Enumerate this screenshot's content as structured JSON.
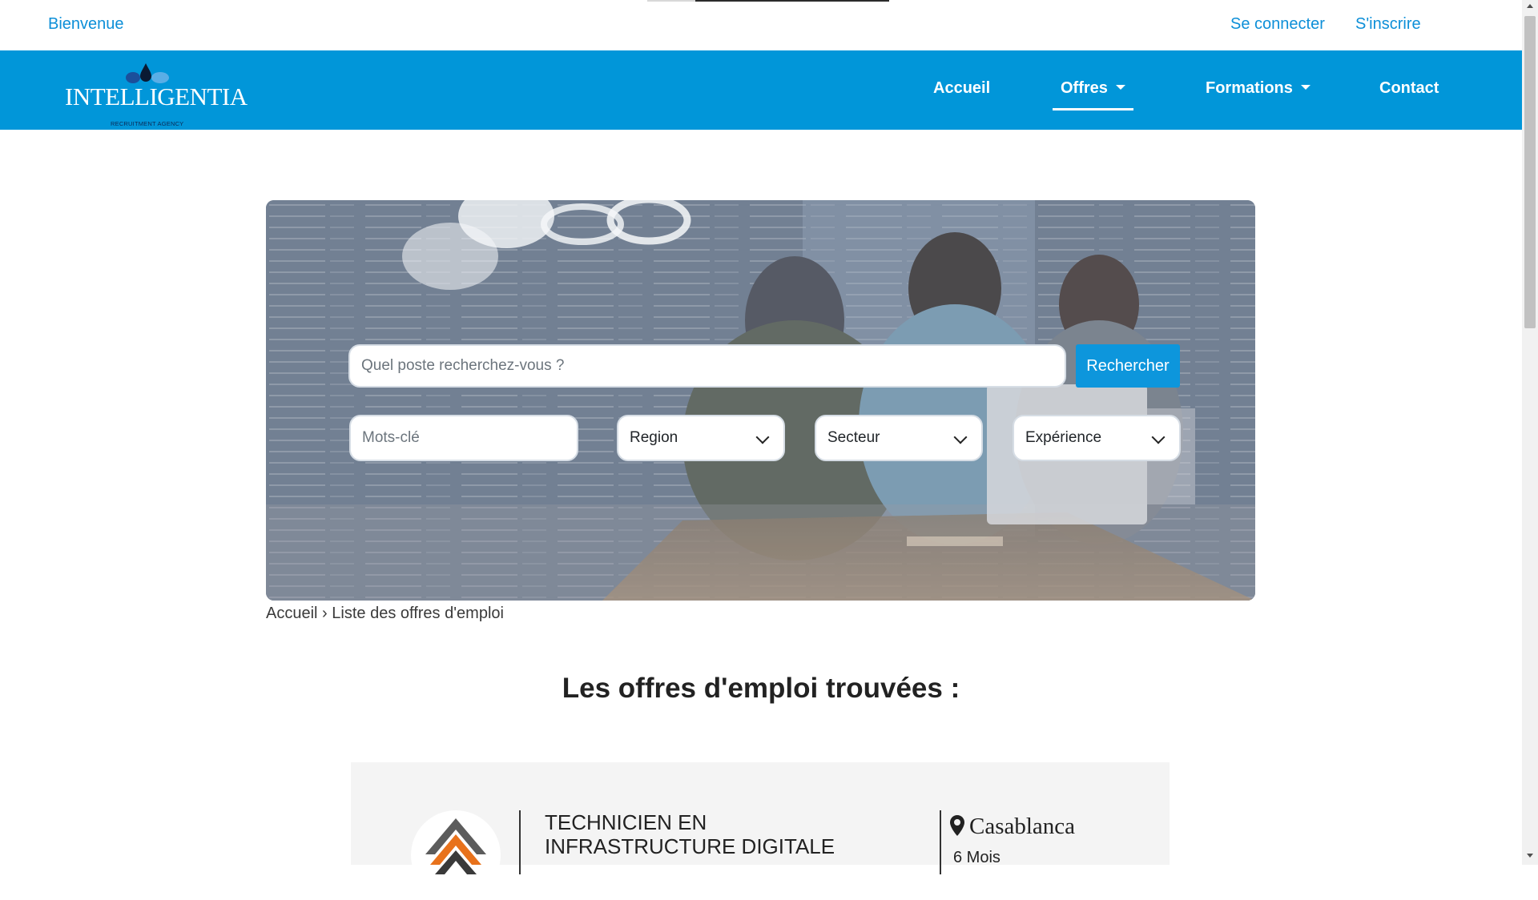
{
  "topbar": {
    "welcome": "Bienvenue",
    "login": "Se connecter",
    "register": "S'inscrire"
  },
  "brand": {
    "name": "INTELLIGENTIA",
    "tagline": "RECRUITMENT AGENCY"
  },
  "nav": {
    "items": [
      {
        "label": "Accueil",
        "dropdown": false,
        "active": false
      },
      {
        "label": "Offres",
        "dropdown": true,
        "active": true
      },
      {
        "label": "Formations",
        "dropdown": true,
        "active": false
      },
      {
        "label": "Contact",
        "dropdown": false,
        "active": false
      }
    ]
  },
  "search": {
    "placeholder": "Quel poste recherchez-vous ?",
    "button": "Rechercher",
    "keywords_placeholder": "Mots-clé",
    "region": "Region",
    "sector": "Secteur",
    "experience": "Expérience"
  },
  "breadcrumb": {
    "home": "Accueil",
    "separator": "›",
    "current": "Liste des offres d'emploi"
  },
  "results": {
    "title": "Les offres d'emploi trouvées :"
  },
  "jobs": [
    {
      "title": "TECHNICIEN EN INFRASTRUCTURE DIGITALE",
      "city": "Casablanca",
      "duration": "6 Mois"
    }
  ],
  "colors": {
    "primary": "#0196d9",
    "link": "#0d8fd8",
    "card_bg": "#f4f4f4"
  },
  "icons": {
    "map_pin": "map-pin-icon",
    "dropdown": "chevron-down-icon"
  }
}
